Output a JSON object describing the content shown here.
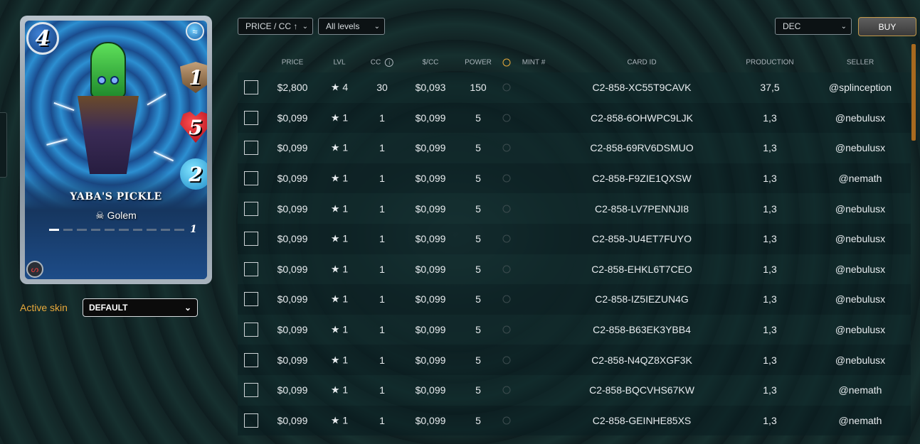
{
  "card": {
    "mana": "4",
    "melee": "1",
    "health": "5",
    "speed": "2",
    "name": "YABA'S PICKLE",
    "type": "Golem",
    "type_icon": "skull-icon",
    "level": "1",
    "xp_fraction": 0.1,
    "element_icon": "water-icon",
    "edition_icon": "edition-logo-icon"
  },
  "skin": {
    "label": "Active skin",
    "value": "DEFAULT"
  },
  "filters": {
    "sort": "PRICE / CC ↑",
    "level": "All levels",
    "currency": "DEC",
    "buy_label": "BUY"
  },
  "table": {
    "headers": {
      "price": "PRICE",
      "lvl": "LVL",
      "cc": "CC",
      "per_cc": "$/CC",
      "power": "POWER",
      "mint": "MINT #",
      "card_id": "CARD ID",
      "production": "PRODUCTION",
      "seller": "SELLER"
    },
    "rows": [
      {
        "price": "$2,800",
        "lvl": "★ 4",
        "cc": "30",
        "per_cc": "$0,093",
        "power": "150",
        "card_id": "C2-858-XC55T9CAVK",
        "production": "37,5",
        "seller": "@splinception"
      },
      {
        "price": "$0,099",
        "lvl": "★ 1",
        "cc": "1",
        "per_cc": "$0,099",
        "power": "5",
        "card_id": "C2-858-6OHWPC9LJK",
        "production": "1,3",
        "seller": "@nebulusx"
      },
      {
        "price": "$0,099",
        "lvl": "★ 1",
        "cc": "1",
        "per_cc": "$0,099",
        "power": "5",
        "card_id": "C2-858-69RV6DSMUO",
        "production": "1,3",
        "seller": "@nebulusx"
      },
      {
        "price": "$0,099",
        "lvl": "★ 1",
        "cc": "1",
        "per_cc": "$0,099",
        "power": "5",
        "card_id": "C2-858-F9ZIE1QXSW",
        "production": "1,3",
        "seller": "@nemath"
      },
      {
        "price": "$0,099",
        "lvl": "★ 1",
        "cc": "1",
        "per_cc": "$0,099",
        "power": "5",
        "card_id": "C2-858-LV7PENNJI8",
        "production": "1,3",
        "seller": "@nebulusx"
      },
      {
        "price": "$0,099",
        "lvl": "★ 1",
        "cc": "1",
        "per_cc": "$0,099",
        "power": "5",
        "card_id": "C2-858-JU4ET7FUYO",
        "production": "1,3",
        "seller": "@nebulusx"
      },
      {
        "price": "$0,099",
        "lvl": "★ 1",
        "cc": "1",
        "per_cc": "$0,099",
        "power": "5",
        "card_id": "C2-858-EHKL6T7CEO",
        "production": "1,3",
        "seller": "@nebulusx"
      },
      {
        "price": "$0,099",
        "lvl": "★ 1",
        "cc": "1",
        "per_cc": "$0,099",
        "power": "5",
        "card_id": "C2-858-IZ5IEZUN4G",
        "production": "1,3",
        "seller": "@nebulusx"
      },
      {
        "price": "$0,099",
        "lvl": "★ 1",
        "cc": "1",
        "per_cc": "$0,099",
        "power": "5",
        "card_id": "C2-858-B63EK3YBB4",
        "production": "1,3",
        "seller": "@nebulusx"
      },
      {
        "price": "$0,099",
        "lvl": "★ 1",
        "cc": "1",
        "per_cc": "$0,099",
        "power": "5",
        "card_id": "C2-858-N4QZ8XGF3K",
        "production": "1,3",
        "seller": "@nebulusx"
      },
      {
        "price": "$0,099",
        "lvl": "★ 1",
        "cc": "1",
        "per_cc": "$0,099",
        "power": "5",
        "card_id": "C2-858-BQCVHS67KW",
        "production": "1,3",
        "seller": "@nemath"
      },
      {
        "price": "$0,099",
        "lvl": "★ 1",
        "cc": "1",
        "per_cc": "$0,099",
        "power": "5",
        "card_id": "C2-858-GEINHE85XS",
        "production": "1,3",
        "seller": "@nemath"
      }
    ]
  },
  "colors": {
    "accent": "#e8a93b",
    "buy_border": "#c49a4a",
    "scroll_thumb": "#a86a1f"
  }
}
